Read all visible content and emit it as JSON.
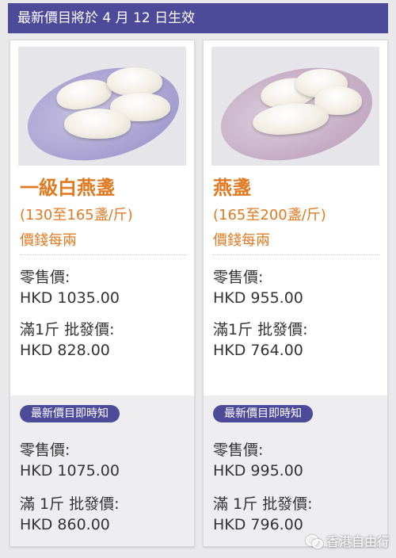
{
  "banner": {
    "text": "最新價目將於 4 月 12 日生效"
  },
  "products": [
    {
      "name": "一級白燕盞",
      "spec": "(130至165盞/斤)",
      "unit_note": "價錢每兩",
      "retail_label": "零售價:",
      "retail_price": "HKD 1035.00",
      "wholesale_label": "滿1斤 批發價:",
      "wholesale_price": "HKD 828.00",
      "update_badge": "最新價目即時知",
      "new_retail_label": "零售價:",
      "new_retail_price": "HKD 1075.00",
      "new_wholesale_label": "滿 1斤 批發價:",
      "new_wholesale_price": "HKD 860.00"
    },
    {
      "name": "燕盞",
      "spec": "(165至200盞/斤)",
      "unit_note": "價錢每兩",
      "retail_label": "零售價:",
      "retail_price": "HKD 955.00",
      "wholesale_label": "滿1斤 批發價:",
      "wholesale_price": "HKD 764.00",
      "update_badge": "最新價目即時知",
      "new_retail_label": "零售價:",
      "new_retail_price": "HKD 995.00",
      "new_wholesale_label": "滿 1斤 批發價:",
      "new_wholesale_price": "HKD 796.00"
    }
  ],
  "watermark": {
    "text": "香港自由行",
    "icon": "wechat-icon"
  },
  "colors": {
    "accent": "#4e4a9a",
    "title": "#e07a22",
    "text": "#333333"
  }
}
